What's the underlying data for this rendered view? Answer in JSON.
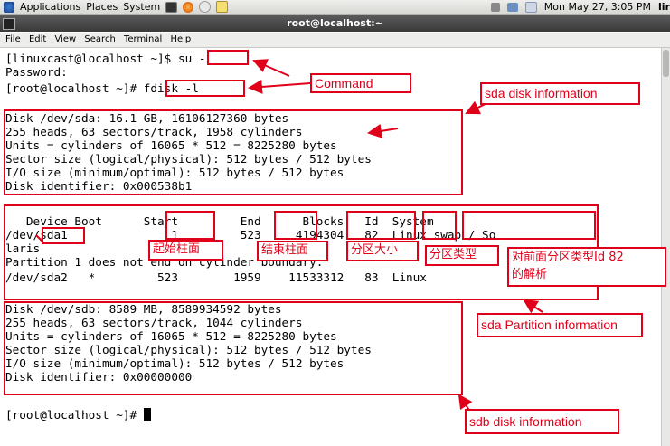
{
  "topbar": {
    "menus": [
      "Applications",
      "Places",
      "System"
    ],
    "clock": "Mon May 27,  3:05 PM",
    "user_truncated": "lir"
  },
  "window": {
    "title": "root@localhost:~"
  },
  "menubar": {
    "items": [
      "File",
      "Edit",
      "View",
      "Search",
      "Terminal",
      "Help"
    ]
  },
  "terminal": {
    "lines": [
      "[linuxcast@localhost ~]$ su -",
      "Password:",
      "[root@localhost ~]# fdisk -l",
      "",
      "",
      "Disk /dev/sda: 16.1 GB, 16106127360 bytes",
      "255 heads, 63 sectors/track, 1958 cylinders",
      "Units = cylinders of 16065 * 512 = 8225280 bytes",
      "Sector size (logical/physical): 512 bytes / 512 bytes",
      "I/O size (minimum/optimal): 512 bytes / 512 bytes",
      "Disk identifier: 0x000538b1",
      "",
      "   Device Boot      Start         End      Blocks   Id  System",
      "/dev/sda1               1         523     4194304   82  Linux swap / So",
      "laris",
      "Partition 1 does not end on cylinder boundary.",
      "/dev/sda2   *         523        1959    11533312   83  Linux",
      "",
      "Disk /dev/sdb: 8589 MB, 8589934592 bytes",
      "255 heads, 63 sectors/track, 1044 cylinders",
      "Units = cylinders of 16065 * 512 = 8225280 bytes",
      "Sector size (logical/physical): 512 bytes / 512 bytes",
      "I/O size (minimum/optimal): 512 bytes / 512 bytes",
      "Disk identifier: 0x00000000",
      "",
      "[root@localhost ~]# "
    ]
  },
  "annotations": {
    "command": "Command",
    "sda_disk": "sda disk information",
    "start_cyl": "起始柱面",
    "end_cyl": "结束柱面",
    "size": "分区大小",
    "type": "分区类型",
    "type_desc_1": "对前面分区类型Id 82",
    "type_desc_2": "的解析",
    "sda_part": "sda Partition information",
    "sdb_disk": "sdb disk information"
  },
  "colors": {
    "annotation": "#e0001a"
  }
}
